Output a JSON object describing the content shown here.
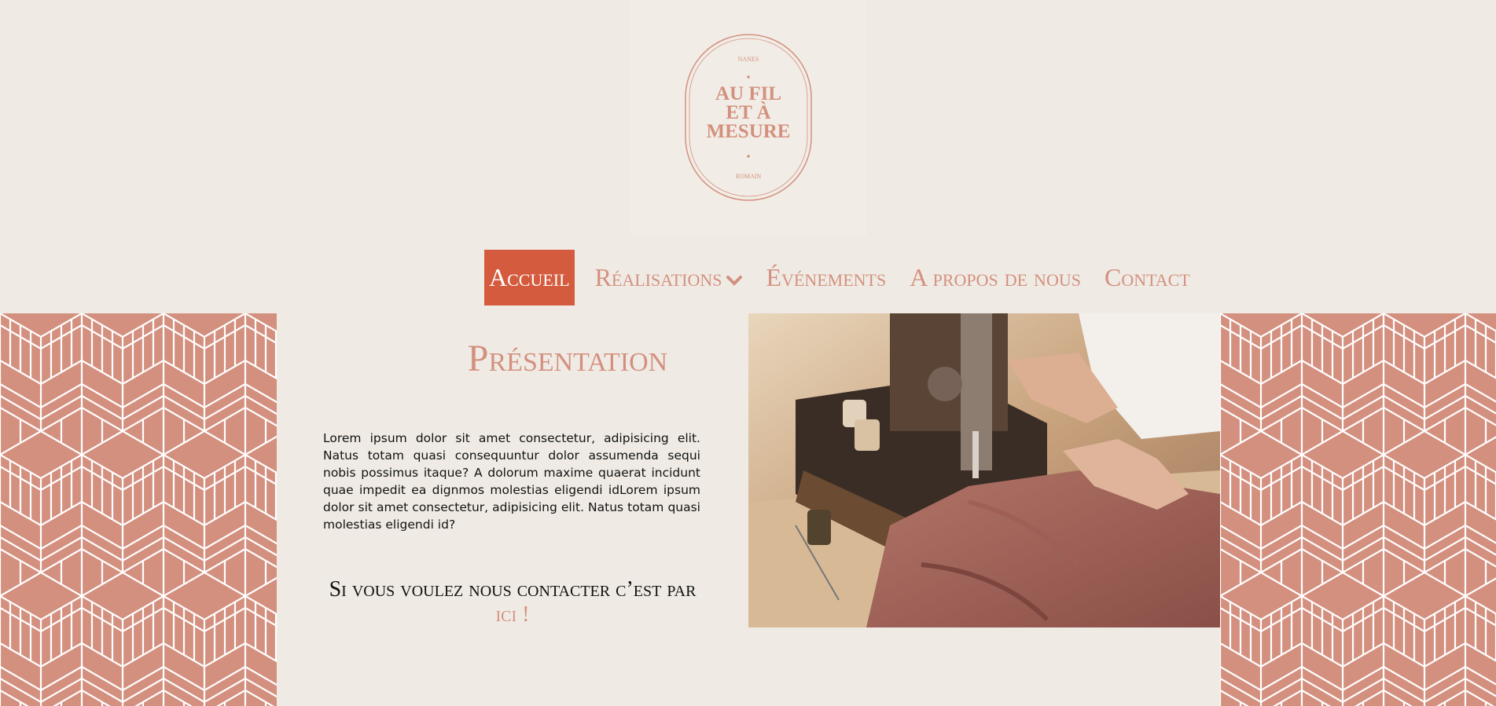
{
  "logo": {
    "top_text": "NANES",
    "line1": "AU FIL",
    "line2": "ET À",
    "line3": "MESURE",
    "bottom_text": "ROMAIN"
  },
  "nav": {
    "items": [
      {
        "label": "Accueil",
        "active": true
      },
      {
        "label": "Réalisations",
        "has_dropdown": true
      },
      {
        "label": "Événements"
      },
      {
        "label": "A propos de nous"
      },
      {
        "label": "Contact"
      }
    ]
  },
  "main": {
    "title": "Présentation",
    "paragraph": "Lorem ipsum dolor sit amet consectetur, adipisicing elit. Natus totam quasi consequuntur dolor assumenda sequi nobis possimus itaque? A dolorum maxime quaerat incidunt quae impedit ea dignmos molestias eligendi idLorem ipsum dolor sit amet consectetur, adipisicing elit. Natus totam quasi molestias eligendi id?",
    "contact_prefix": "Si vous voulez nous contacter c’est par ",
    "contact_link": "ici !"
  },
  "colors": {
    "background": "#efebe4",
    "accent": "#d4907f",
    "active_nav": "#d55b3e",
    "pattern": "#d4907f"
  },
  "icons": {
    "dropdown": "chevron-down-icon"
  }
}
